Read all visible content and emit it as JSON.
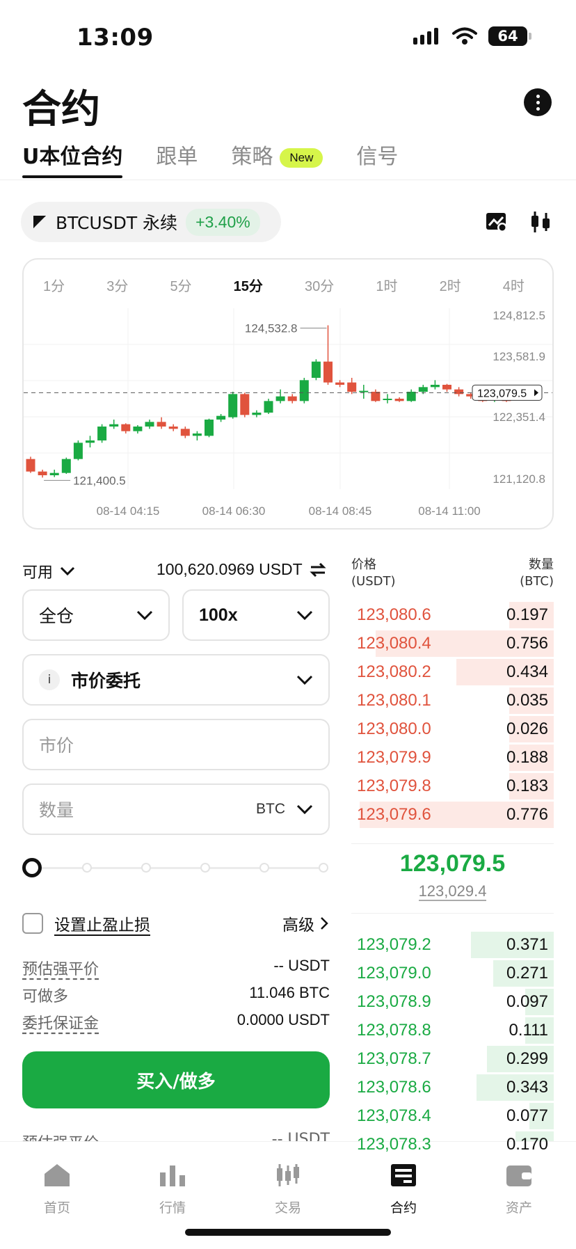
{
  "status": {
    "time": "13:09",
    "battery": "64"
  },
  "header": {
    "title": "合约"
  },
  "tabs": [
    {
      "label": "U本位合约",
      "active": true
    },
    {
      "label": "跟单",
      "active": false
    },
    {
      "label": "策略",
      "active": false,
      "badge": "New"
    },
    {
      "label": "信号",
      "active": false
    }
  ],
  "ticker": {
    "symbol": "BTCUSDT 永续",
    "change": "+3.40%"
  },
  "chart": {
    "intervals": [
      "1分",
      "3分",
      "5分",
      "15分",
      "30分",
      "1时",
      "2时",
      "4时"
    ],
    "active_interval": "15分",
    "price_axis": [
      "124,812.5",
      "123,581.9",
      "122,351.4",
      "121,120.8"
    ],
    "time_axis": [
      "08-14 04:15",
      "08-14 06:30",
      "08-14 08:45",
      "08-14 11:00"
    ],
    "high_label": "124,532.8",
    "low_label": "121,400.5",
    "current_tag": "123,079.5"
  },
  "chart_data": {
    "type": "candlestick",
    "ylim": [
      121000,
      124900
    ],
    "candles": [
      [
        121650,
        121380,
        121700,
        121350
      ],
      [
        121380,
        121300,
        121420,
        121250
      ],
      [
        121300,
        121350,
        121420,
        121260
      ],
      [
        121350,
        121650,
        121680,
        121330
      ],
      [
        121650,
        122000,
        122050,
        121620
      ],
      [
        122000,
        122050,
        122150,
        121900
      ],
      [
        122050,
        122350,
        122400,
        122000
      ],
      [
        122350,
        122400,
        122500,
        122300
      ],
      [
        122400,
        122250,
        122420,
        122200
      ],
      [
        122250,
        122350,
        122380,
        122200
      ],
      [
        122350,
        122450,
        122500,
        122300
      ],
      [
        122450,
        122350,
        122550,
        122300
      ],
      [
        122350,
        122300,
        122400,
        122250
      ],
      [
        122300,
        122150,
        122350,
        122100
      ],
      [
        122150,
        122200,
        122250,
        122050
      ],
      [
        122150,
        122500,
        122520,
        122120
      ],
      [
        122500,
        122580,
        122620,
        122450
      ],
      [
        122550,
        123050,
        123100,
        122520
      ],
      [
        123050,
        122600,
        123080,
        122550
      ],
      [
        122600,
        122650,
        122700,
        122550
      ],
      [
        122650,
        122900,
        122950,
        122620
      ],
      [
        122900,
        123000,
        123150,
        122850
      ],
      [
        123000,
        122900,
        123050,
        122850
      ],
      [
        122900,
        123350,
        123400,
        122850
      ],
      [
        123400,
        123750,
        123800,
        123350
      ],
      [
        123750,
        123300,
        124532.8,
        123250
      ],
      [
        123300,
        123250,
        123350,
        123200
      ],
      [
        123300,
        123100,
        123400,
        123050
      ],
      [
        123100,
        123120,
        123250,
        122950
      ],
      [
        123100,
        122900,
        123150,
        122880
      ],
      [
        122950,
        122950,
        123050,
        122850
      ],
      [
        122950,
        122900,
        122980,
        122880
      ],
      [
        122900,
        123100,
        123150,
        122880
      ],
      [
        123100,
        123200,
        123250,
        123050
      ],
      [
        123200,
        123250,
        123350,
        123150
      ],
      [
        123250,
        123150,
        123270,
        123100
      ],
      [
        123150,
        123050,
        123200,
        123000
      ],
      [
        123050,
        123000,
        123080,
        122950
      ],
      [
        123000,
        122900,
        123050,
        122880
      ],
      [
        122950,
        122950,
        123000,
        122880
      ],
      [
        122980,
        122900,
        123000,
        122880
      ]
    ],
    "current_price": 123079.5
  },
  "form": {
    "available_label": "可用",
    "available_value": "100,620.0969 USDT",
    "margin_mode": "全仓",
    "leverage": "100x",
    "order_type": "市价委托",
    "price_placeholder": "市价",
    "qty_placeholder": "数量",
    "qty_unit": "BTC",
    "slider_percent": 0,
    "tpsl_label": "设置止盈止损",
    "advanced_label": "高级",
    "info": [
      {
        "key": "预估强平价",
        "value": "-- USDT"
      },
      {
        "key": "可做多",
        "value": "11.046 BTC"
      },
      {
        "key": "委托保证金",
        "value": "0.0000 USDT"
      }
    ],
    "buy_label": "买入/做多",
    "cut_key": "预估强平价",
    "cut_value": "-- USDT"
  },
  "orderbook": {
    "price_header": "价格",
    "price_unit": "(USDT)",
    "qty_header": "数量",
    "qty_unit": "(BTC)",
    "asks": [
      {
        "price": "123,080.6",
        "qty": "0.197",
        "depth": 0.22
      },
      {
        "price": "123,080.4",
        "qty": "0.756",
        "depth": 0.88
      },
      {
        "price": "123,080.2",
        "qty": "0.434",
        "depth": 0.48
      },
      {
        "price": "123,080.1",
        "qty": "0.035",
        "depth": 0.22
      },
      {
        "price": "123,080.0",
        "qty": "0.026",
        "depth": 0.22
      },
      {
        "price": "123,079.9",
        "qty": "0.188",
        "depth": 0.22
      },
      {
        "price": "123,079.8",
        "qty": "0.183",
        "depth": 0.22
      },
      {
        "price": "123,079.6",
        "qty": "0.776",
        "depth": 0.96
      }
    ],
    "last_price": "123,079.5",
    "mark_price": "123,029.4",
    "bids": [
      {
        "price": "123,079.2",
        "qty": "0.371",
        "depth": 0.41
      },
      {
        "price": "123,079.0",
        "qty": "0.271",
        "depth": 0.3
      },
      {
        "price": "123,078.9",
        "qty": "0.097",
        "depth": 0.14
      },
      {
        "price": "123,078.8",
        "qty": "0.111",
        "depth": 0.14
      },
      {
        "price": "123,078.7",
        "qty": "0.299",
        "depth": 0.33
      },
      {
        "price": "123,078.6",
        "qty": "0.343",
        "depth": 0.38
      },
      {
        "price": "123,078.4",
        "qty": "0.077",
        "depth": 0.12
      },
      {
        "price": "123,078.3",
        "qty": "0.170",
        "depth": 0.19
      }
    ]
  },
  "nav": [
    {
      "label": "首页",
      "icon": "home-icon",
      "active": false
    },
    {
      "label": "行情",
      "icon": "market-icon",
      "active": false
    },
    {
      "label": "交易",
      "icon": "trade-icon",
      "active": false
    },
    {
      "label": "合约",
      "icon": "futures-icon",
      "active": true
    },
    {
      "label": "资产",
      "icon": "wallet-icon",
      "active": false
    }
  ],
  "colors": {
    "up": "#1aaa43",
    "down": "#e0533d",
    "badge": "#d6f54a"
  }
}
